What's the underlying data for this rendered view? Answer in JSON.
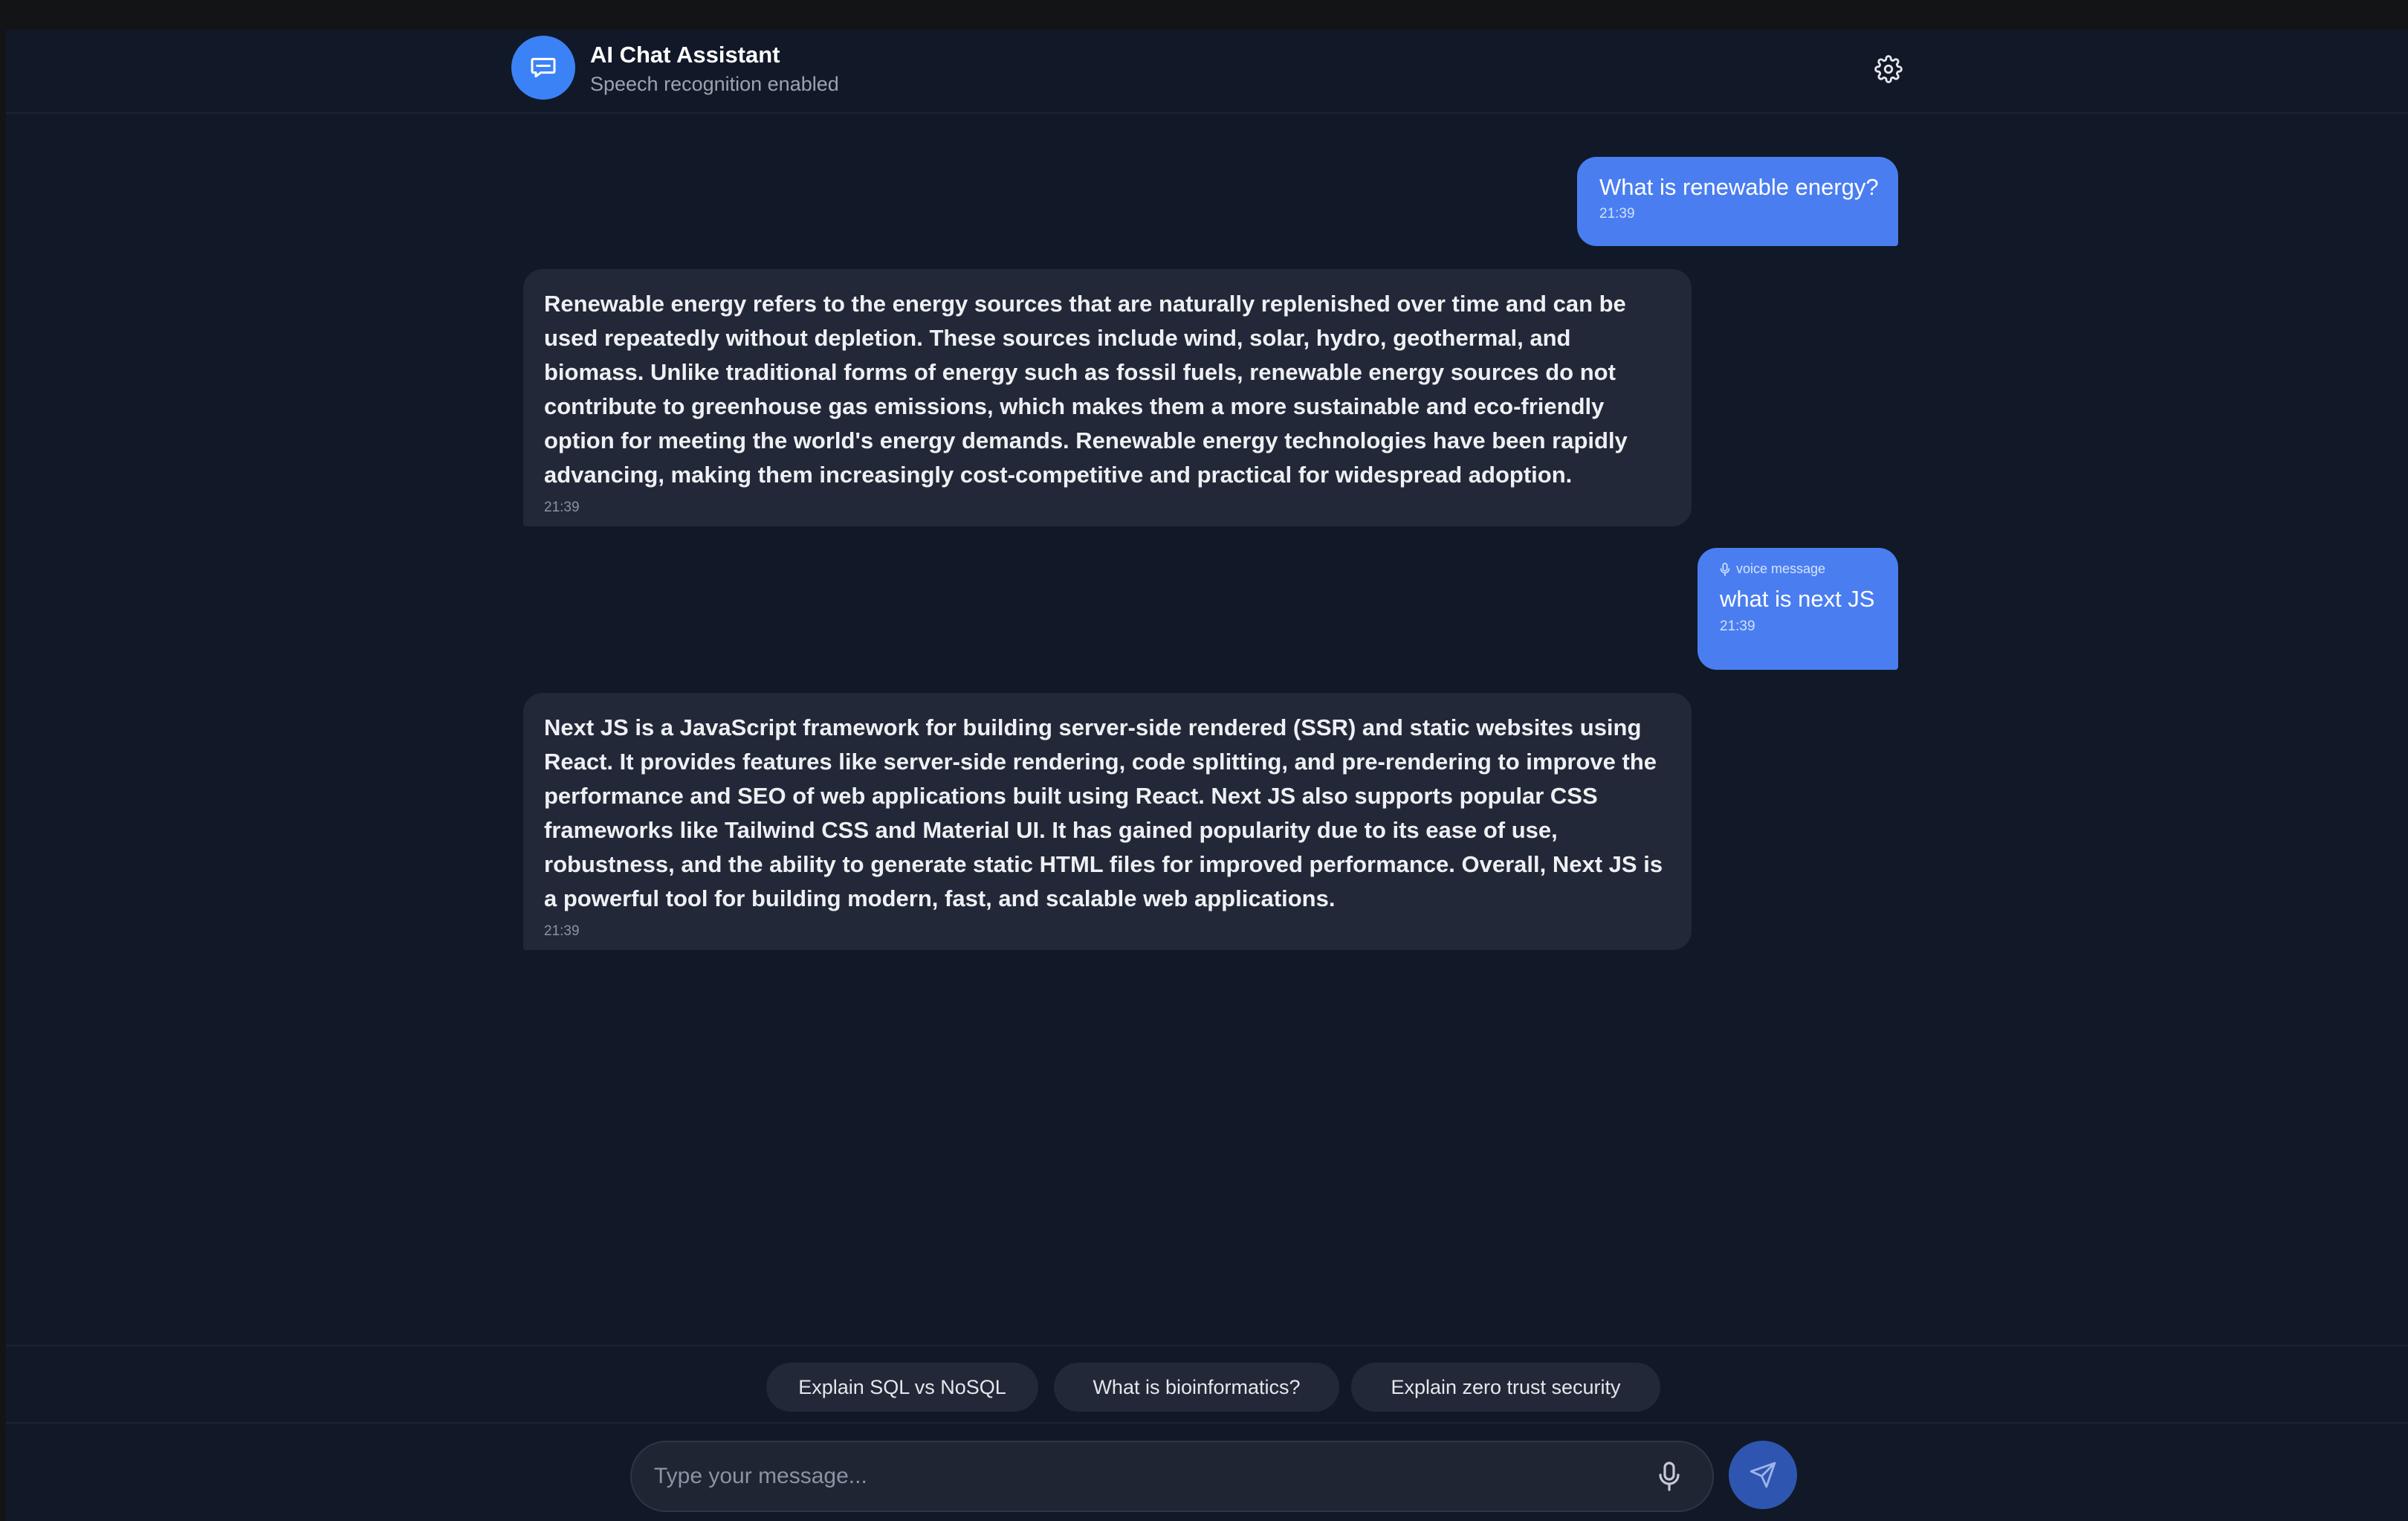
{
  "header": {
    "title": "AI Chat Assistant",
    "subtitle": "Speech recognition enabled",
    "avatar_icon": "chat-bubble-icon",
    "settings_icon": "gear-icon"
  },
  "messages": [
    {
      "role": "user",
      "text": "What is renewable energy?",
      "time": "21:39"
    },
    {
      "role": "assistant",
      "text": "Renewable energy refers to the energy sources that are naturally replenished over time and can be used repeatedly without depletion. These sources include wind, solar, hydro, geothermal, and biomass. Unlike traditional forms of energy such as fossil fuels, renewable energy sources do not contribute to greenhouse gas emissions, which makes them a more sustainable and eco-friendly option for meeting the world's energy demands. Renewable energy technologies have been rapidly advancing, making them increasingly cost-competitive and practical for widespread adoption.",
      "time": "21:39"
    },
    {
      "role": "user",
      "voice_label": "voice message",
      "text": "what is next JS",
      "time": "21:39"
    },
    {
      "role": "assistant",
      "text": "Next JS is a JavaScript framework for building server-side rendered (SSR) and static websites using React. It provides features like server-side rendering, code splitting, and pre-rendering to improve the performance and SEO of web applications built using React. Next JS also supports popular CSS frameworks like Tailwind CSS and Material UI. It has gained popularity due to its ease of use, robustness, and the ability to generate static HTML files for improved performance. Overall, Next JS is a powerful tool for building modern, fast, and scalable web applications.",
      "time": "21:39"
    }
  ],
  "suggestions": [
    "Explain SQL vs NoSQL",
    "What is bioinformatics?",
    "Explain zero trust security"
  ],
  "composer": {
    "placeholder": "Type your message...",
    "mic_icon": "microphone-icon",
    "send_icon": "send-icon"
  },
  "colors": {
    "background": "#111827",
    "user_bubble": "#4a7ef0",
    "assistant_bubble": "#222837",
    "accent": "#3b82f6"
  }
}
